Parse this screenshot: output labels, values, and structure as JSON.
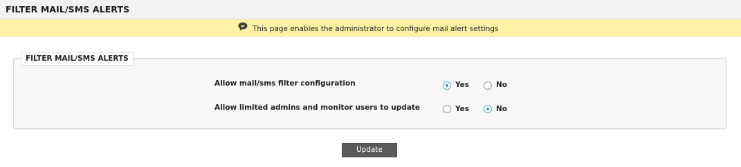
{
  "header": {
    "title": "FILTER MAIL/SMS ALERTS"
  },
  "info_bar": {
    "icon": "speech-bubble-icon",
    "text": "This page enables the administrator to configure mail alert settings",
    "background": "#fcf4a4"
  },
  "section": {
    "legend": "FILTER MAIL/SMS ALERTS",
    "rows": [
      {
        "label": "Allow mail/sms filter configuration",
        "options": [
          {
            "label": "Yes",
            "checked": true
          },
          {
            "label": "No",
            "checked": false
          }
        ]
      },
      {
        "label": "Allow limited admins and monitor users to update",
        "options": [
          {
            "label": "Yes",
            "checked": false
          },
          {
            "label": "No",
            "checked": true
          }
        ]
      }
    ]
  },
  "actions": {
    "update_label": "Update"
  },
  "colors": {
    "radio_selected": "#3a8fb8",
    "button_bg": "#5a5a5a"
  }
}
